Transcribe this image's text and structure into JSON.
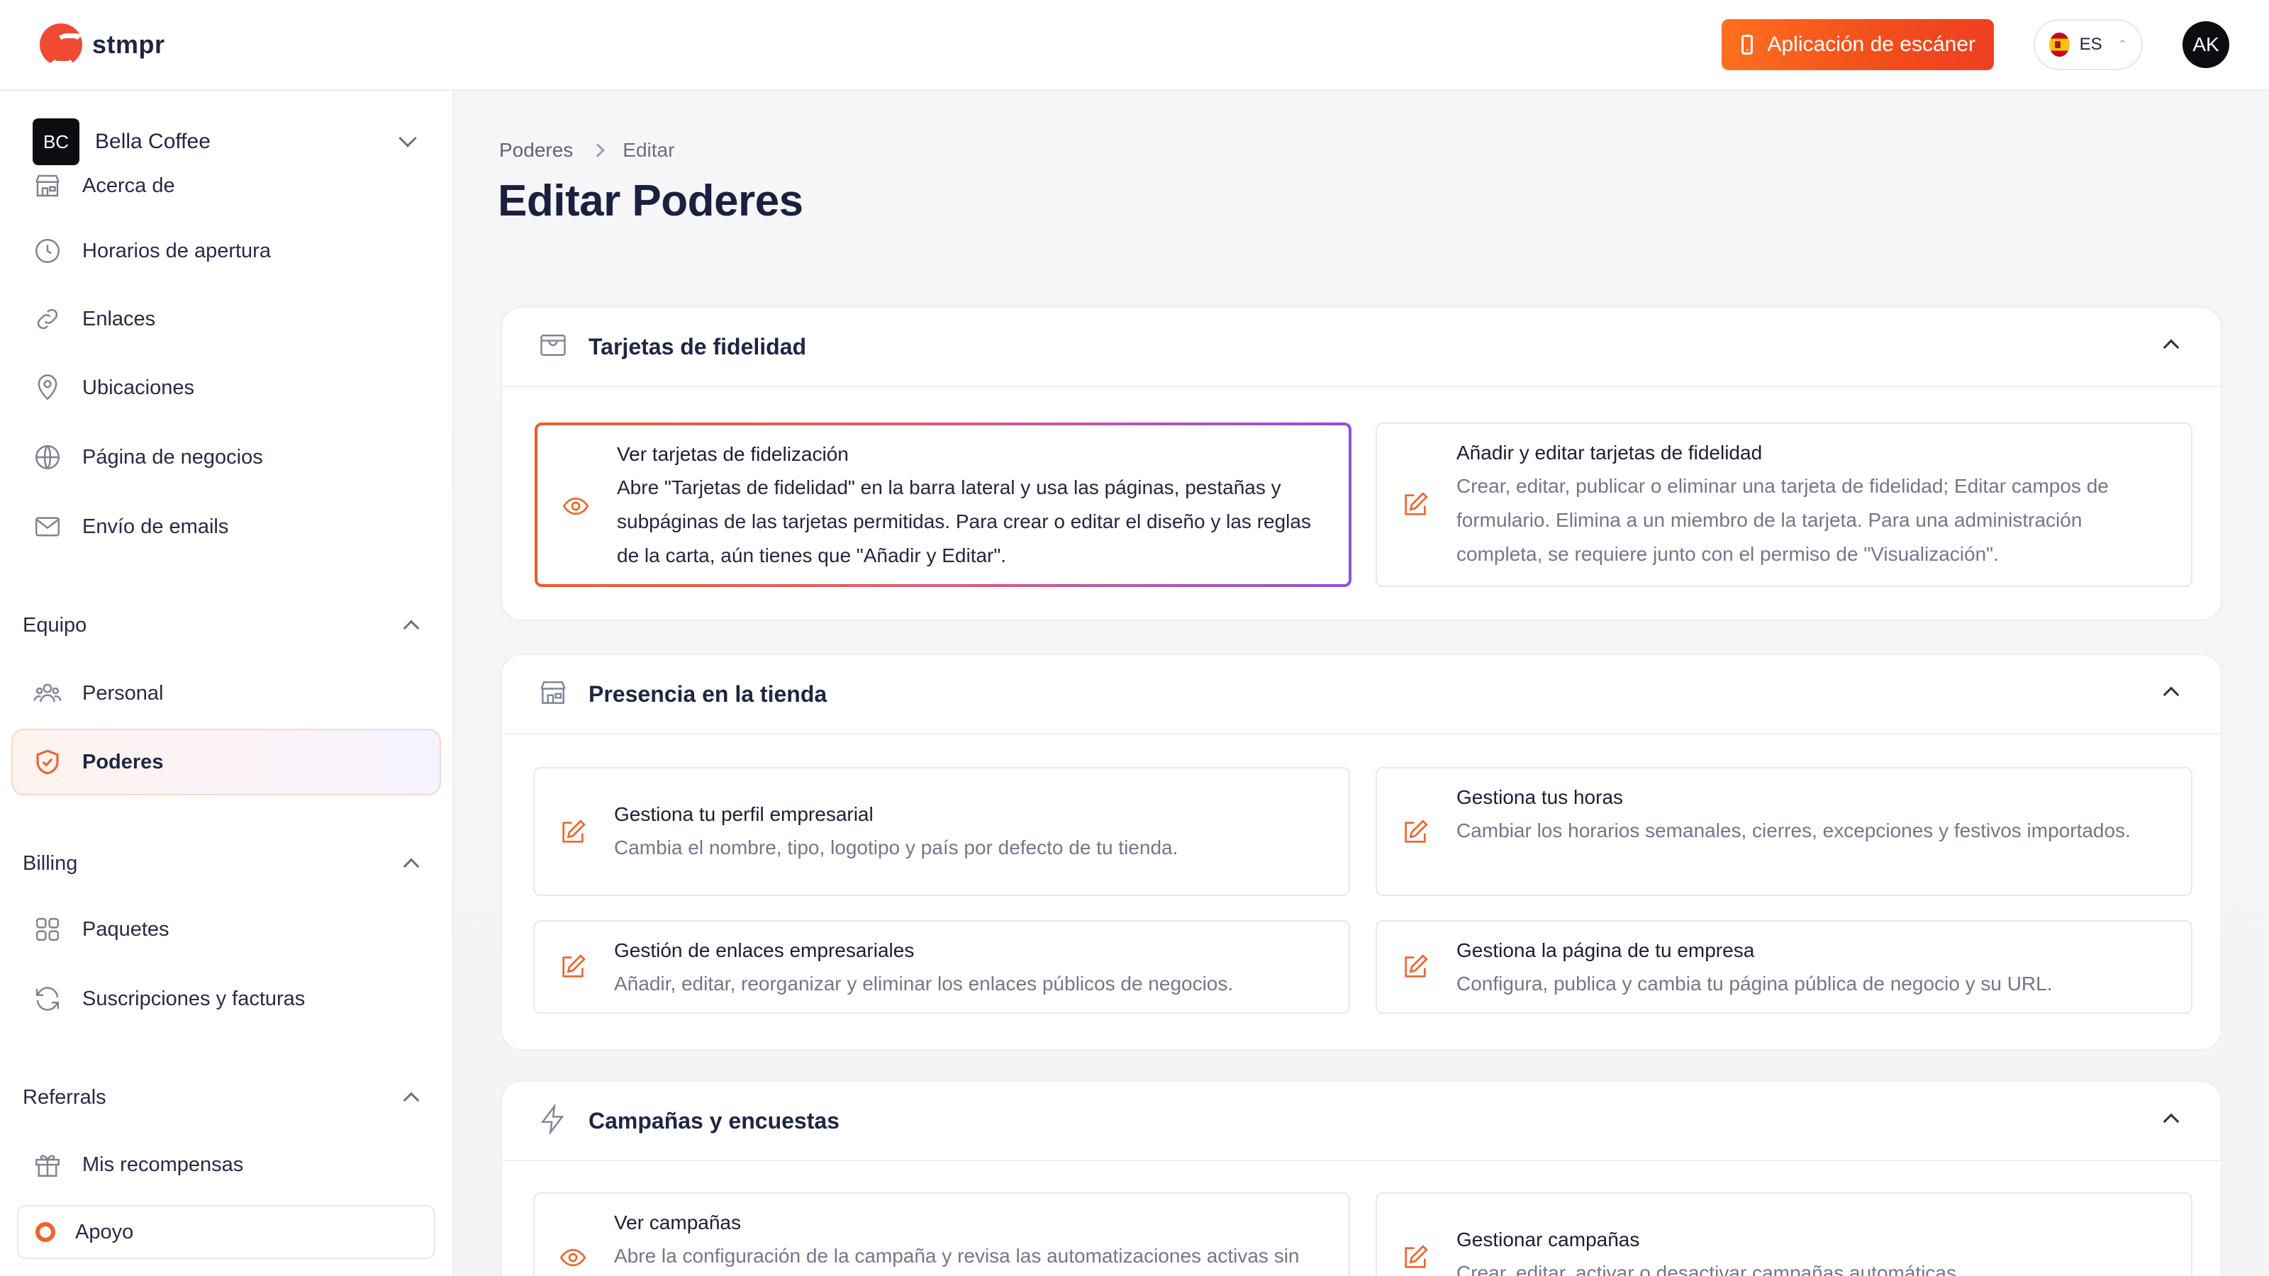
{
  "app": {
    "logo_text": "stmpr"
  },
  "topbar": {
    "scanner_button": "Aplicación de escáner",
    "language": "ES",
    "user_initials": "AK"
  },
  "sidebar": {
    "org": {
      "initials": "BC",
      "name": "Bella Coffee"
    },
    "items_store": [
      {
        "label": "Acerca de",
        "icon": "store-icon"
      },
      {
        "label": "Horarios de apertura",
        "icon": "clock-icon"
      },
      {
        "label": "Enlaces",
        "icon": "link-icon"
      },
      {
        "label": "Ubicaciones",
        "icon": "map-pin-icon"
      },
      {
        "label": "Página de negocios",
        "icon": "globe-icon"
      },
      {
        "label": "Envío de emails",
        "icon": "mail-icon"
      }
    ],
    "team_section": {
      "title": "Equipo",
      "items": [
        {
          "label": "Personal",
          "icon": "users-icon"
        },
        {
          "label": "Poderes",
          "icon": "shield-check-icon",
          "active": true
        }
      ]
    },
    "billing_section": {
      "title": "Billing",
      "items": [
        {
          "label": "Paquetes",
          "icon": "grid-icon"
        },
        {
          "label": "Suscripciones y facturas",
          "icon": "refresh-icon"
        }
      ]
    },
    "referrals_section": {
      "title": "Referrals",
      "items": [
        {
          "label": "Mis recompensas",
          "icon": "gift-icon"
        }
      ]
    },
    "support": {
      "label": "Apoyo",
      "icon": "lifebuoy-icon"
    }
  },
  "breadcrumb": {
    "parent": "Poderes",
    "current": "Editar"
  },
  "page_title": "Editar Poderes",
  "panels": [
    {
      "title": "Tarjetas de fidelidad",
      "icon": "card-icon",
      "cards": [
        {
          "title": "Ver tarjetas de fidelización",
          "description": "Abre \"Tarjetas de fidelidad\" en la barra lateral y usa las páginas, pestañas y subpáginas de las tarjetas permitidas. Para crear o editar el diseño y las reglas de la carta, aún tienes que \"Añadir y Editar\".",
          "icon": "eye-icon",
          "selected": true
        },
        {
          "title": "Añadir y editar tarjetas de fidelidad",
          "description": "Crear, editar, publicar o eliminar una tarjeta de fidelidad; Editar campos de formulario. Elimina a un miembro de la tarjeta. Para una administración completa, se requiere junto con el permiso de \"Visualización\".",
          "icon": "edit-icon",
          "selected": false
        }
      ]
    },
    {
      "title": "Presencia en la tienda",
      "icon": "store-icon",
      "cards": [
        {
          "title": "Gestiona tu perfil empresarial",
          "description": "Cambia el nombre, tipo, logotipo y país por defecto de tu tienda.",
          "icon": "edit-icon"
        },
        {
          "title": "Gestiona tus horas",
          "description": "Cambiar los horarios semanales, cierres, excepciones y festivos importados.",
          "icon": "edit-icon"
        },
        {
          "title": "Gestión de enlaces empresariales",
          "description": "Añadir, editar, reorganizar y eliminar los enlaces públicos de negocios.",
          "icon": "edit-icon"
        },
        {
          "title": "Gestiona la página de tu empresa",
          "description": "Configura, publica y cambia tu página pública de negocio y su URL.",
          "icon": "edit-icon"
        }
      ]
    },
    {
      "title": "Campañas y encuestas",
      "icon": "zap-icon",
      "cards": [
        {
          "title": "Ver campañas",
          "description": "Abre la configuración de la campaña y revisa las automatizaciones activas sin",
          "icon": "eye-icon"
        },
        {
          "title": "Gestionar campañas",
          "description": "Crear, editar, activar o desactivar campañas automáticas",
          "icon": "edit-icon"
        }
      ]
    }
  ],
  "colors": {
    "accent": "#f25c29",
    "brand_gradient_start": "#ff6f1f",
    "brand_gradient_end": "#ee4021",
    "selected_border_end": "#8e4fe6",
    "text_primary": "#1f2544",
    "text_muted": "#72788a"
  }
}
